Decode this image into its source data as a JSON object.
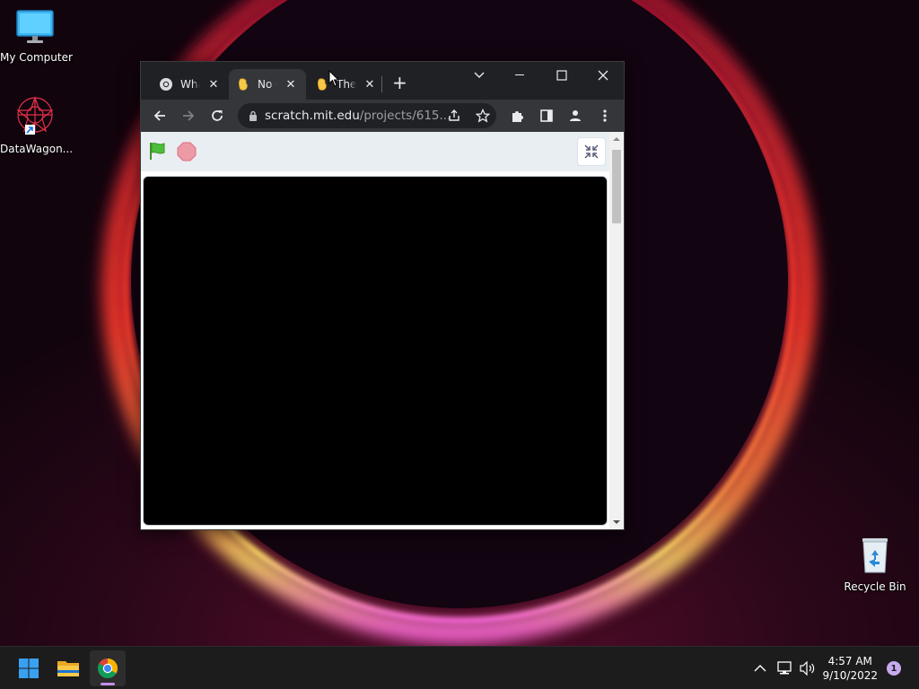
{
  "desktop": {
    "icons": [
      {
        "label": "My Computer",
        "icon": "monitor-icon"
      },
      {
        "label": "DataWagon...",
        "icon": "datawagon-icon"
      },
      {
        "label": "Recycle Bin",
        "icon": "recycle-bin-icon"
      }
    ]
  },
  "browser": {
    "tabs": [
      {
        "title": "What",
        "icon": "chrome-icon",
        "active": false
      },
      {
        "title": "No c",
        "icon": "scratch-icon",
        "active": true
      },
      {
        "title": "The",
        "icon": "scratch-icon",
        "active": false
      }
    ],
    "new_tab_label": "+",
    "url_domain": "scratch.mit.edu",
    "url_path": "/projects/615...",
    "colors": {
      "frame": "#202124",
      "toolbar": "#35363a",
      "stage": "#000000"
    }
  },
  "scratch": {
    "green_flag_icon": "green-flag-icon",
    "stop_icon": "stop-icon",
    "fullscreen_exit_icon": "exit-fullscreen-icon"
  },
  "taskbar": {
    "apps": [
      "start-icon",
      "file-explorer-icon",
      "chrome-icon"
    ],
    "time": "4:57 AM",
    "date": "9/10/2022",
    "notification_count": "1"
  }
}
